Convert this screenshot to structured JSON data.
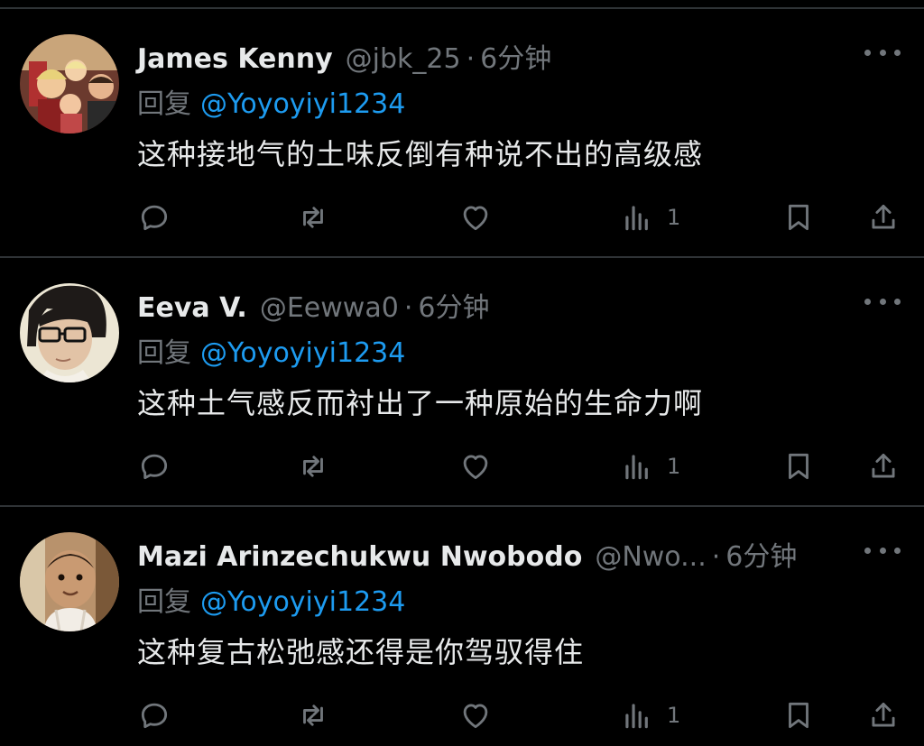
{
  "replies": [
    {
      "display_name": "James Kenny",
      "handle": "@jbk_25",
      "separator": "·",
      "time": "6分钟",
      "reply_prefix": "回复",
      "mention": "@Yoyoyiyi1234",
      "text": "这种接地气的土味反倒有种说不出的高级感",
      "views": "1"
    },
    {
      "display_name": "Eeva V.",
      "handle": "@Eewwa0",
      "separator": "·",
      "time": "6分钟",
      "reply_prefix": "回复",
      "mention": "@Yoyoyiyi1234",
      "text": "这种土气感反而衬出了一种原始的生命力啊",
      "views": "1"
    },
    {
      "display_name": "Mazi Arinzechukwu Nwobodo",
      "handle": "@Nwo...",
      "separator": "·",
      "time": "6分钟",
      "reply_prefix": "回复",
      "mention": "@Yoyoyiyi1234",
      "text": "这种复古松弛感还得是你驾驭得住",
      "views": "1"
    }
  ],
  "icons": {
    "reply": "reply-icon",
    "retweet": "retweet-icon",
    "like": "heart-icon",
    "views": "views-icon",
    "bookmark": "bookmark-icon",
    "share": "share-icon",
    "more": "more-icon"
  },
  "colors": {
    "background": "#000000",
    "text": "#e7e9ea",
    "muted": "#71767b",
    "link": "#1d9bf0",
    "divider": "#2f3336"
  }
}
